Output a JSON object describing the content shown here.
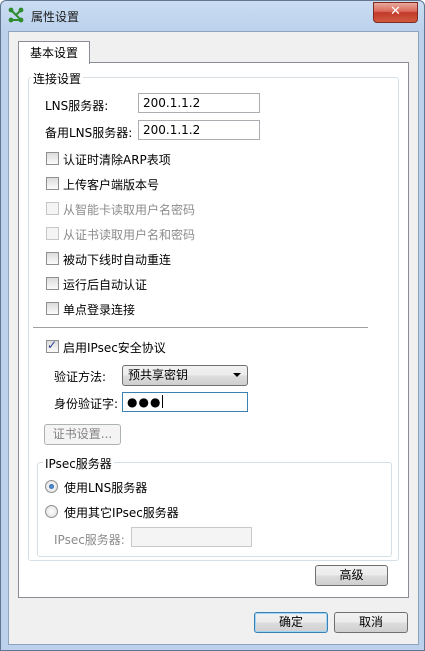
{
  "window": {
    "title": "属性设置",
    "close_glyph": "✕",
    "accent_color": "#3c7fb1"
  },
  "tabs": [
    {
      "label": "基本设置",
      "selected": true
    }
  ],
  "connection": {
    "group_title": "连接设置",
    "lns_label": "LNS服务器:",
    "lns_value": "200.1.1.2",
    "backup_lns_label": "备用LNS服务器:",
    "backup_lns_value": "200.1.1.2",
    "options": [
      {
        "label": "认证时清除ARP表项",
        "checked": false,
        "enabled": true
      },
      {
        "label": "上传客户端版本号",
        "checked": false,
        "enabled": true
      },
      {
        "label": "从智能卡读取用户名密码",
        "checked": false,
        "enabled": false
      },
      {
        "label": "从证书读取用户名和密码",
        "checked": false,
        "enabled": false
      },
      {
        "label": "被动下线时自动重连",
        "checked": false,
        "enabled": true
      },
      {
        "label": "运行后自动认证",
        "checked": false,
        "enabled": true
      },
      {
        "label": "单点登录连接",
        "checked": false,
        "enabled": true
      }
    ],
    "ipsec_enable_label": "启用IPsec安全协议",
    "ipsec_enabled": true,
    "auth_method_label": "验证方法:",
    "auth_method_value": "预共享密钥",
    "identity_label": "身份验证字:",
    "identity_mask": "●●●",
    "cert_settings_label": "证书设置..."
  },
  "ipsec_server": {
    "group_title": "IPsec服务器",
    "radio_lns_label": "使用LNS服务器",
    "radio_other_label": "使用其它IPsec服务器",
    "selected": "lns",
    "server_label": "IPsec服务器:",
    "server_value": ""
  },
  "buttons": {
    "advanced": "高级",
    "ok": "确定",
    "cancel": "取消"
  }
}
